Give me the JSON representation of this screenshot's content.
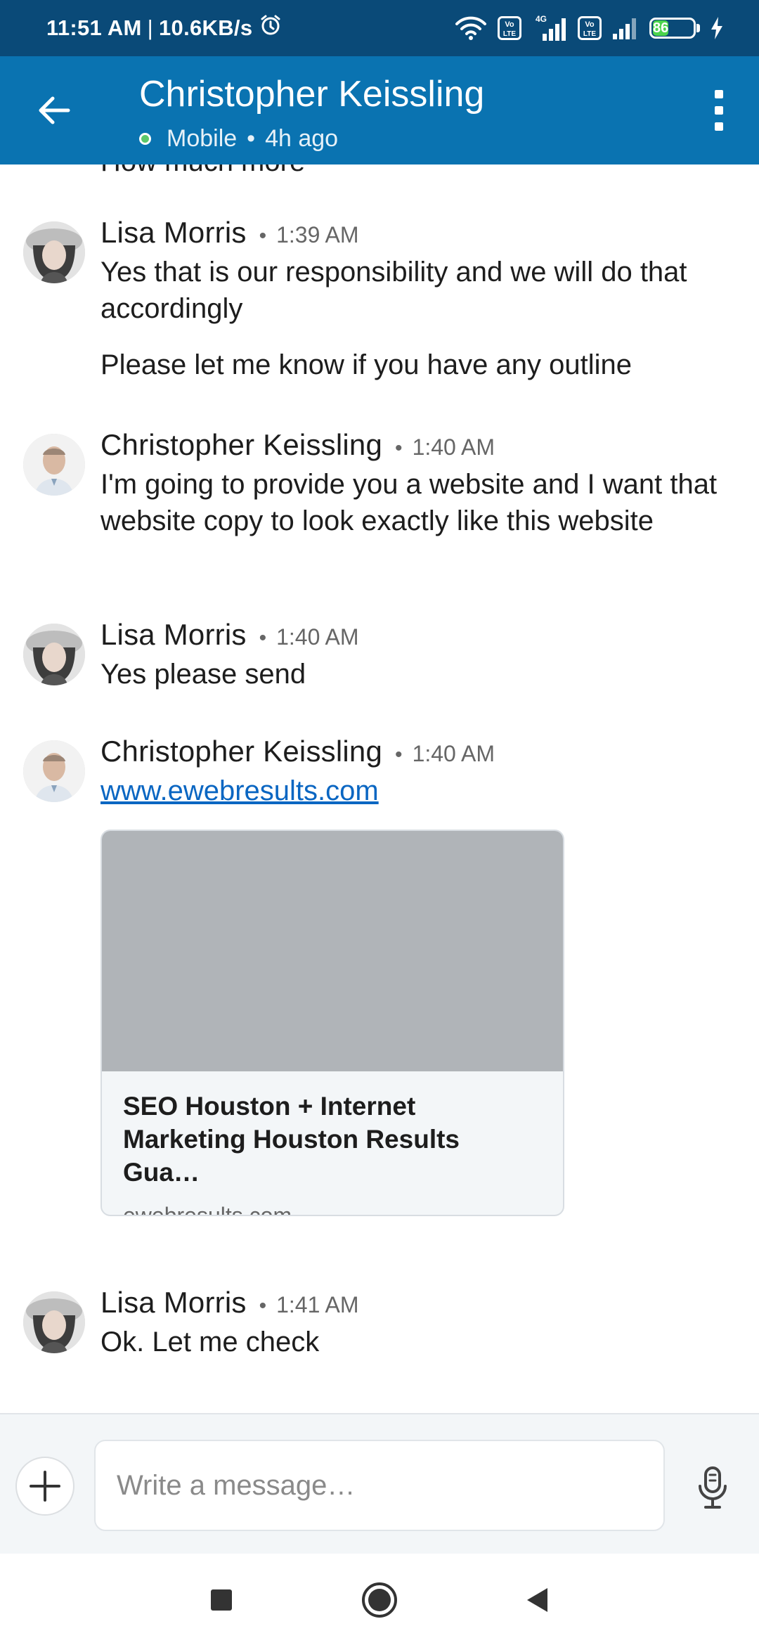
{
  "status_bar": {
    "time": "11:51 AM",
    "separator": "|",
    "network_speed": "10.6KB/s",
    "network_type": "4G",
    "volte_label": "Vo LTE",
    "battery_level": "86",
    "icons": [
      "alarm-icon",
      "wifi-icon",
      "volte-icon",
      "signal-icon",
      "battery-icon",
      "charging-icon"
    ]
  },
  "header": {
    "title": "Christopher Keissling",
    "presence_status": "Mobile",
    "presence_separator": "•",
    "last_active": "4h ago",
    "colors": {
      "statusbar": "#0a4a78",
      "appbar": "#0a73b1",
      "presence": "#5cc86b"
    }
  },
  "conversation": {
    "cut_off_text": "How much more",
    "meta_separator": "•",
    "messages": [
      {
        "sender": "Lisa Morris",
        "time": "1:39 AM",
        "paragraphs": [
          "Yes that is our responsibility and we will do that accordingly",
          "Please let me know if you have any outline"
        ]
      },
      {
        "sender": "Christopher Keissling",
        "time": "1:40 AM",
        "paragraphs": [
          "I'm going to provide you a website and I want that website copy to look exactly like this website"
        ]
      },
      {
        "sender": "Lisa Morris",
        "time": "1:40 AM",
        "paragraphs": [
          "Yes please send"
        ]
      },
      {
        "sender": "Christopher Keissling",
        "time": "1:40 AM",
        "link": "www.ewebresults.com",
        "preview": {
          "title": "SEO Houston + Internet\nMarketing Houston Results Gua…",
          "domain": "ewebresults.com"
        }
      },
      {
        "sender": "Lisa Morris",
        "time": "1:41 AM",
        "paragraphs": [
          "Ok. Let me check"
        ]
      }
    ]
  },
  "composer": {
    "placeholder": "Write a message…",
    "icons": [
      "plus-icon",
      "microphone-icon"
    ]
  },
  "navigation": {
    "icons": [
      "recent-apps-icon",
      "home-icon",
      "back-icon"
    ]
  }
}
